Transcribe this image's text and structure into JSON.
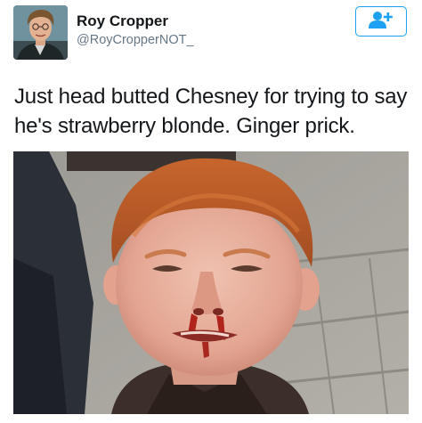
{
  "tweet": {
    "display_name": "Roy Cropper",
    "handle": "@RoyCropperNOT_",
    "text": "Just head butted Chesney for trying to say he's strawberry blonde. Ginger prick.",
    "follow_icon": "add-user-icon",
    "accent_color": "#1da1f2"
  }
}
